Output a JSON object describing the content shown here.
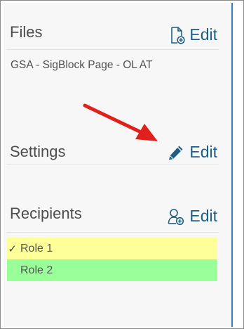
{
  "files": {
    "title": "Files",
    "edit_label": "Edit",
    "edit_icon": "add-file-icon",
    "items": [
      "GSA - SigBlock Page - OL AT"
    ]
  },
  "settings": {
    "title": "Settings",
    "edit_label": "Edit",
    "edit_icon": "pencil-icon"
  },
  "recipients": {
    "title": "Recipients",
    "edit_label": "Edit",
    "edit_icon": "add-user-icon",
    "roles": [
      {
        "label": "Role 1",
        "checked": "✓",
        "color": "#ffff99"
      },
      {
        "label": "Role 2",
        "checked": "",
        "color": "#99ff99"
      }
    ]
  },
  "colors": {
    "accent": "#1e5f86",
    "panel_border": "#3d80b5",
    "annotation_arrow": "#e0201b"
  }
}
